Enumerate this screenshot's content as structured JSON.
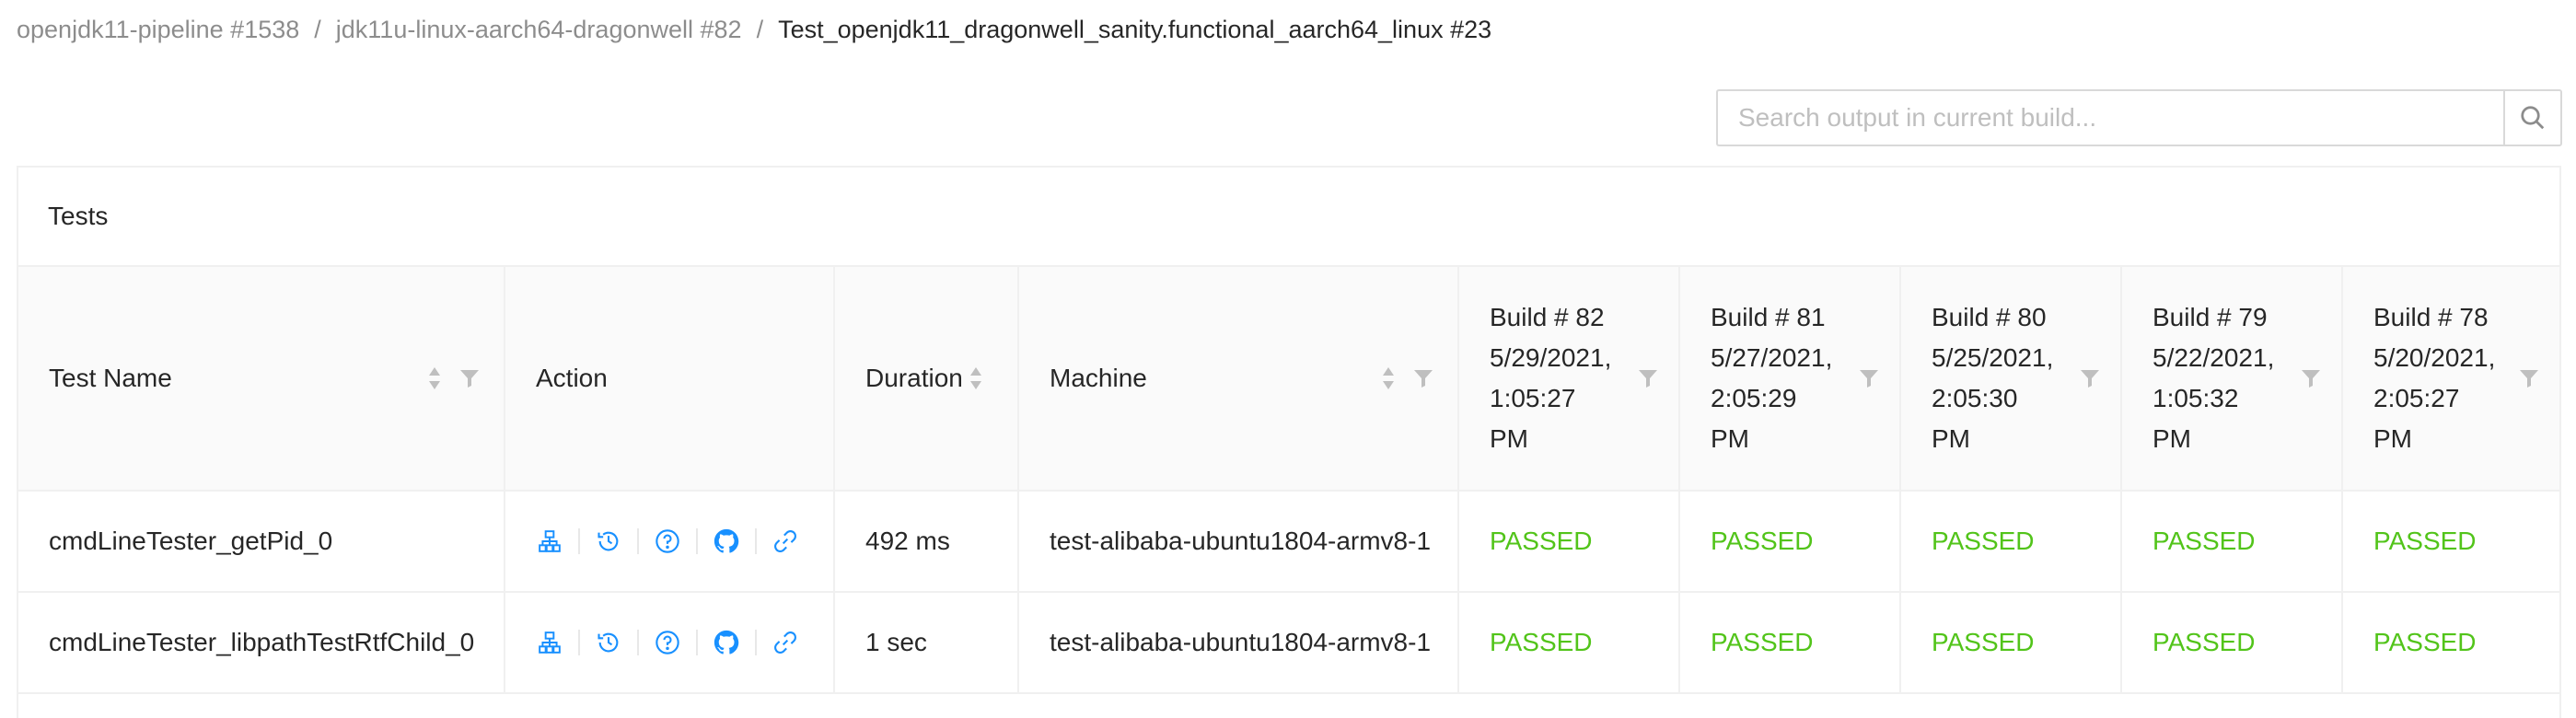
{
  "breadcrumb": {
    "items": [
      {
        "label": "openjdk11-pipeline #1538"
      },
      {
        "label": "jdk11u-linux-aarch64-dragonwell #82"
      },
      {
        "label": "Test_openjdk11_dragonwell_sanity.functional_aarch64_linux #23"
      }
    ],
    "separator": "/"
  },
  "search": {
    "placeholder": "Search output in current build..."
  },
  "card": {
    "title": "Tests"
  },
  "columns": {
    "test_name": "Test Name",
    "action": "Action",
    "duration": "Duration",
    "machine": "Machine",
    "builds": [
      {
        "line1": "Build # 82",
        "line2": "5/29/2021,",
        "line3": "1:05:27",
        "line4": "PM"
      },
      {
        "line1": "Build # 81",
        "line2": "5/27/2021,",
        "line3": "2:05:29",
        "line4": "PM"
      },
      {
        "line1": "Build # 80",
        "line2": "5/25/2021,",
        "line3": "2:05:30",
        "line4": "PM"
      },
      {
        "line1": "Build # 79",
        "line2": "5/22/2021,",
        "line3": "1:05:32",
        "line4": "PM"
      },
      {
        "line1": "Build # 78",
        "line2": "5/20/2021,",
        "line3": "2:05:27",
        "line4": "PM"
      }
    ]
  },
  "rows": [
    {
      "test_name": "cmdLineTester_getPid_0",
      "duration": "492 ms",
      "machine": "test-alibaba-ubuntu1804-armv8-1",
      "results": [
        "PASSED",
        "PASSED",
        "PASSED",
        "PASSED",
        "PASSED"
      ]
    },
    {
      "test_name": "cmdLineTester_libpathTestRtfChild_0",
      "duration": "1 sec",
      "machine": "test-alibaba-ubuntu1804-armv8-1",
      "results": [
        "PASSED",
        "PASSED",
        "PASSED",
        "PASSED",
        "PASSED"
      ]
    }
  ],
  "action_icons": [
    "tree-icon",
    "history-icon",
    "question-icon",
    "github-icon",
    "link-icon"
  ],
  "colors": {
    "passed": "#52c41a",
    "icon": "#1890ff",
    "border": "#f0f0f0",
    "header_bg": "#fafafa"
  }
}
